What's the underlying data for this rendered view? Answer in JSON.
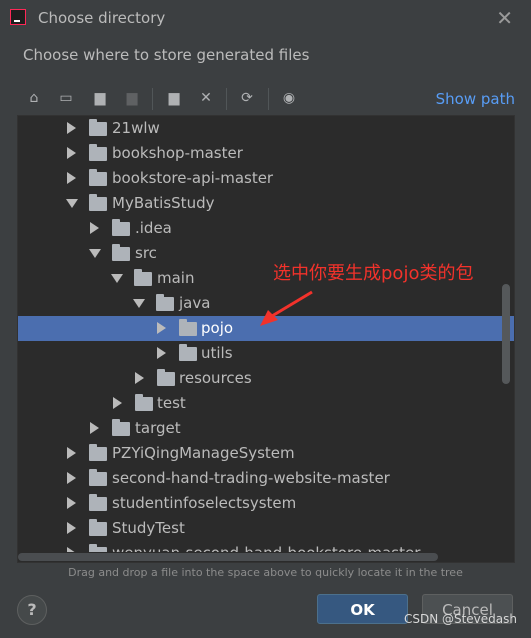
{
  "window": {
    "title": "Choose directory"
  },
  "subtitle": "Choose where to store generated files",
  "toolbar": {
    "show_path": "Show path"
  },
  "tree": {
    "rows": [
      {
        "label": "21wlw",
        "expanded": false
      },
      {
        "label": "bookshop-master",
        "expanded": false
      },
      {
        "label": "bookstore-api-master",
        "expanded": false
      },
      {
        "label": "MyBatisStudy",
        "expanded": true
      },
      {
        "label": ".idea",
        "expanded": false
      },
      {
        "label": "src",
        "expanded": true
      },
      {
        "label": "main",
        "expanded": true
      },
      {
        "label": "java",
        "expanded": true
      },
      {
        "label": "pojo",
        "expanded": false,
        "selected": true
      },
      {
        "label": "utils",
        "expanded": false
      },
      {
        "label": "resources",
        "expanded": false
      },
      {
        "label": "test",
        "expanded": false
      },
      {
        "label": "target",
        "expanded": false
      },
      {
        "label": "PZYiQingManageSystem",
        "expanded": false
      },
      {
        "label": "second-hand-trading-website-master",
        "expanded": false
      },
      {
        "label": "studentinfoselectsystem",
        "expanded": false
      },
      {
        "label": "StudyTest",
        "expanded": false
      },
      {
        "label": "wenyuan-second-hand-bookstore-master",
        "expanded": false
      }
    ]
  },
  "annotation": "选中你要生成pojo类的包",
  "hint": "Drag and drop a file into the space above to quickly locate it in the tree",
  "buttons": {
    "help": "?",
    "ok": "OK",
    "cancel": "Cancel"
  },
  "watermark": "CSDN @Stevedash",
  "colors": {
    "selection": "#4b6eaf",
    "annotation": "#f2322b",
    "link": "#589df6"
  }
}
